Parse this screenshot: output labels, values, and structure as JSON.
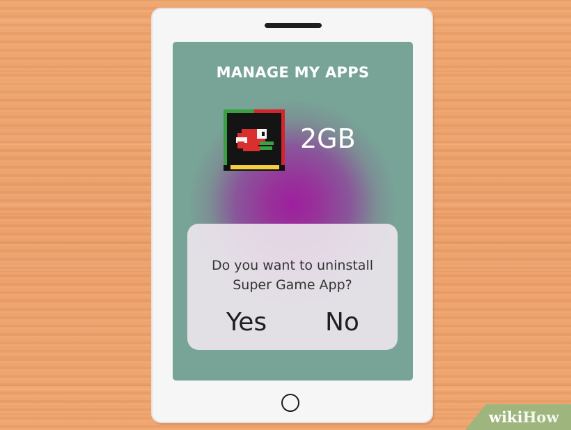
{
  "screen": {
    "title": "MANAGE MY APPS",
    "app": {
      "icon": "flappy-bird-icon",
      "size": "2GB"
    }
  },
  "dialog": {
    "message_line1": "Do you want to uninstall",
    "message_line2": "Super Game App?",
    "yes_label": "Yes",
    "no_label": "No"
  },
  "watermark": {
    "brand_part1": "wiki",
    "brand_part2": "How"
  },
  "colors": {
    "background": "#eda069",
    "phone_body": "#f6f6f6",
    "screen_edge": "#78a497",
    "screen_center": "#9e1f9e",
    "dialog_bg": "#ebe4ec",
    "watermark_bg": "#9fb57e"
  }
}
